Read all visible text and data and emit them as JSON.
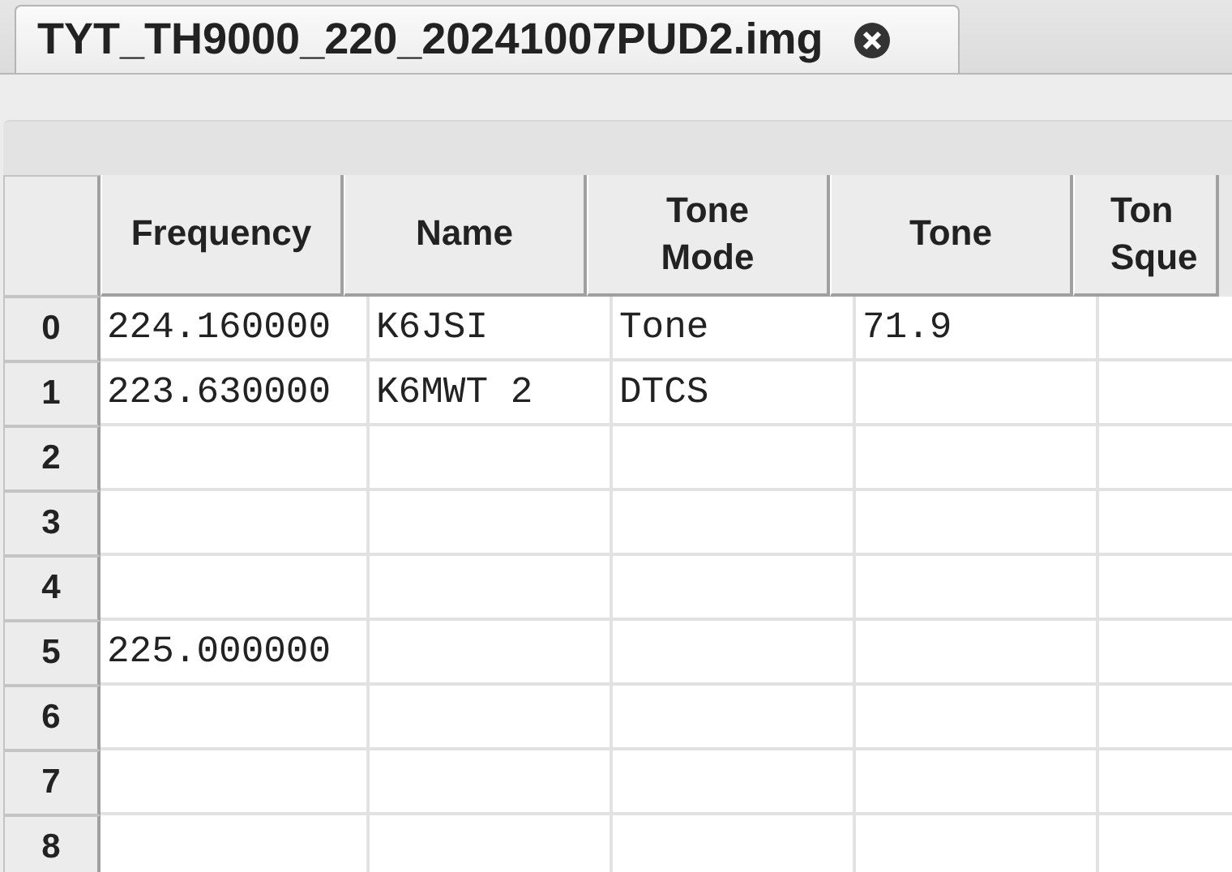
{
  "tab": {
    "title": "TYT_TH9000_220_20241007PUD2.img",
    "selected": true
  },
  "table": {
    "columns": [
      "Frequency",
      "Name",
      "Tone\nMode",
      "Tone",
      "Ton\nSque"
    ],
    "rows": [
      {
        "index": "0",
        "cells": [
          "224.160000",
          "K6JSI",
          "Tone",
          "71.9",
          ""
        ]
      },
      {
        "index": "1",
        "cells": [
          "223.630000",
          "K6MWT 2",
          "DTCS",
          "",
          ""
        ]
      },
      {
        "index": "2",
        "cells": [
          "",
          "",
          "",
          "",
          ""
        ]
      },
      {
        "index": "3",
        "cells": [
          "",
          "",
          "",
          "",
          ""
        ]
      },
      {
        "index": "4",
        "cells": [
          "",
          "",
          "",
          "",
          ""
        ]
      },
      {
        "index": "5",
        "cells": [
          "225.000000",
          "",
          "",
          "",
          ""
        ]
      },
      {
        "index": "6",
        "cells": [
          "",
          "",
          "",
          "",
          ""
        ]
      },
      {
        "index": "7",
        "cells": [
          "",
          "",
          "",
          "",
          ""
        ]
      },
      {
        "index": "8",
        "cells": [
          "",
          "",
          "",
          "",
          ""
        ]
      }
    ]
  }
}
